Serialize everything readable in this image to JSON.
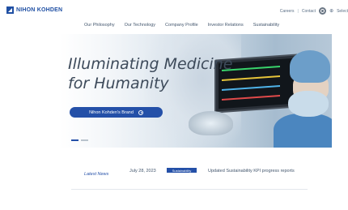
{
  "header": {
    "logo_text": "NIHON KOHDEN",
    "top_links": [
      "Careers",
      "Contact"
    ],
    "language": "Select",
    "nav": [
      "Our Philosophy",
      "Our Technology",
      "Company Profile",
      "Investor Relations",
      "Sustainability"
    ]
  },
  "hero": {
    "headline_line1": "Illuminating Medicine",
    "headline_line2": "for Humanity",
    "cta_label": "Nihon Kohden's Brand",
    "carousel_active_index": 0,
    "carousel_count": 2
  },
  "news": {
    "label": "Latest News",
    "date": "July 28, 2023",
    "badge": "Sustainability",
    "title": "Updated Sustainability KPI progress reports"
  },
  "colors": {
    "brand_blue": "#2450a8",
    "text_gray": "#44576e"
  }
}
